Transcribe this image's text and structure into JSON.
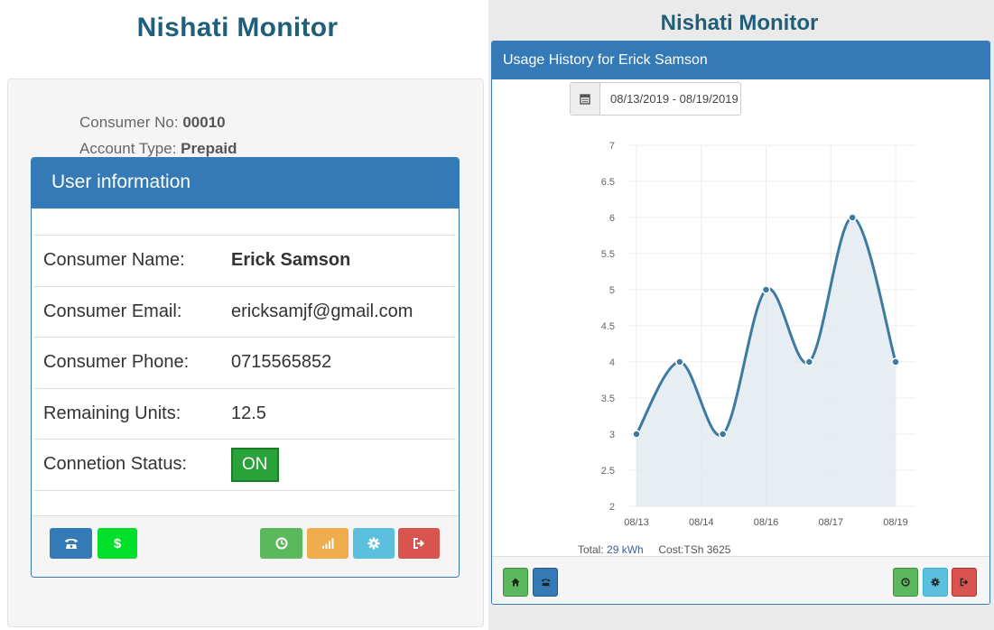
{
  "left": {
    "app_title": "Nishati Monitor",
    "consumer_no_label": "Consumer No: ",
    "consumer_no": "00010",
    "account_type_label": "Account Type: ",
    "account_type": "Prepaid",
    "panel_title": "User information",
    "rows": [
      {
        "label": "Consumer Name:",
        "value": "Erick Samson"
      },
      {
        "label": "Consumer Email:",
        "value": "ericksamjf@gmail.com"
      },
      {
        "label": "Consumer Phone:",
        "value": "0715565852"
      },
      {
        "label": "Remaining Units:",
        "value": "12.5"
      },
      {
        "label": "Connetion Status:",
        "value": "ON"
      }
    ],
    "footer_buttons": [
      {
        "icon": "phone-icon",
        "color": "#337ab7"
      },
      {
        "icon": "dollar-icon",
        "label": "$",
        "color": "#00e02a"
      },
      {
        "icon": "clock-icon",
        "color": "#5cb85c"
      },
      {
        "icon": "signal-icon",
        "color": "#f0ad4e"
      },
      {
        "icon": "gear-icon",
        "color": "#5bc0de"
      },
      {
        "icon": "sign-out-icon",
        "color": "#d9534f"
      }
    ]
  },
  "right": {
    "app_title": "Nishati Monitor",
    "panel_title": "Usage History for Erick Samson",
    "date_range": "08/13/2019 - 08/19/2019",
    "total_label": "Total: ",
    "total_value": "29 kWh",
    "cost_label": "Cost:",
    "cost_value": "TSh 3625",
    "footer_buttons": [
      {
        "icon": "home-icon",
        "color": "#5cb85c"
      },
      {
        "icon": "phone-icon",
        "color": "#337ab7"
      },
      {
        "icon": "clock-icon",
        "color": "#5cb85c"
      },
      {
        "icon": "gear-icon",
        "color": "#5bc0de"
      },
      {
        "icon": "sign-out-icon",
        "color": "#d9534f"
      }
    ]
  },
  "chart_data": {
    "type": "area",
    "x": [
      "08/13",
      "08/14",
      "08/14",
      "08/16",
      "08/16",
      "08/17",
      "08/19"
    ],
    "x_tick_labels": [
      "08/13",
      "08/14",
      "08/16",
      "08/17",
      "08/19"
    ],
    "series": [
      {
        "values": [
          3,
          4,
          3,
          5,
          4,
          6,
          4
        ],
        "color": "#3c7aa0"
      }
    ],
    "y_ticks": [
      "2",
      "2.5",
      "3",
      "3.5",
      "4",
      "4.5",
      "5",
      "5.5",
      "6",
      "6.5",
      "7"
    ],
    "ylim": [
      2,
      7
    ],
    "grid": true
  }
}
